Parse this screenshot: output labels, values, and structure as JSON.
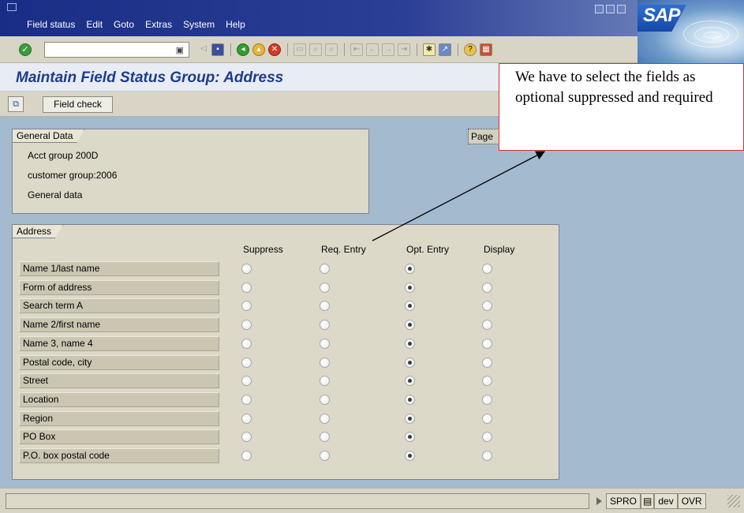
{
  "menubar": {
    "items": [
      "Field status",
      "Edit",
      "Goto",
      "Extras",
      "System",
      "Help"
    ],
    "logo": "SAP"
  },
  "toolbar": {
    "command_value": "",
    "icons": [
      "ok-icon",
      "save-icon",
      "back-icon",
      "exit-icon",
      "cancel-icon",
      "print-icon",
      "find-icon",
      "find-next-icon",
      "first-page-icon",
      "previous-page-icon",
      "next-page-icon",
      "last-page-icon",
      "create-session-icon",
      "shortcut-icon",
      "help-icon",
      "layout-icon"
    ]
  },
  "page": {
    "title": "Maintain Field Status Group: Address"
  },
  "app_toolbar": {
    "field_check_label": "Field check"
  },
  "general": {
    "tab_label": "General Data",
    "lines": [
      "Acct group  200D",
      "customer group:2006",
      "General data"
    ]
  },
  "page_button": "Page",
  "address": {
    "tab_label": "Address",
    "columns": [
      "Suppress",
      "Req. Entry",
      "Opt. Entry",
      "Display"
    ],
    "rows": [
      {
        "label": "Name 1/last name",
        "selected": "Opt. Entry"
      },
      {
        "label": "Form of address",
        "selected": "Opt. Entry"
      },
      {
        "label": "Search term A",
        "selected": "Opt. Entry"
      },
      {
        "label": "Name 2/first name",
        "selected": "Opt. Entry"
      },
      {
        "label": "Name 3, name 4",
        "selected": "Opt. Entry"
      },
      {
        "label": "Postal code, city",
        "selected": "Opt. Entry"
      },
      {
        "label": "Street",
        "selected": "Opt. Entry"
      },
      {
        "label": "Location",
        "selected": "Opt. Entry"
      },
      {
        "label": "Region",
        "selected": "Opt. Entry"
      },
      {
        "label": "PO Box",
        "selected": "Opt. Entry"
      },
      {
        "label": "P.O. box postal code",
        "selected": "Opt. Entry"
      }
    ]
  },
  "statusbar": {
    "transaction": "SPRO",
    "system": "dev",
    "mode": "OVR"
  },
  "annotation": {
    "text": "We have to select the fields as optional suppressed and required"
  },
  "colors": {
    "title_blue": "#1f3c8a",
    "workarea": "#a3bacf",
    "panel": "#dcd9c8",
    "callout_border": "#cc3333"
  }
}
